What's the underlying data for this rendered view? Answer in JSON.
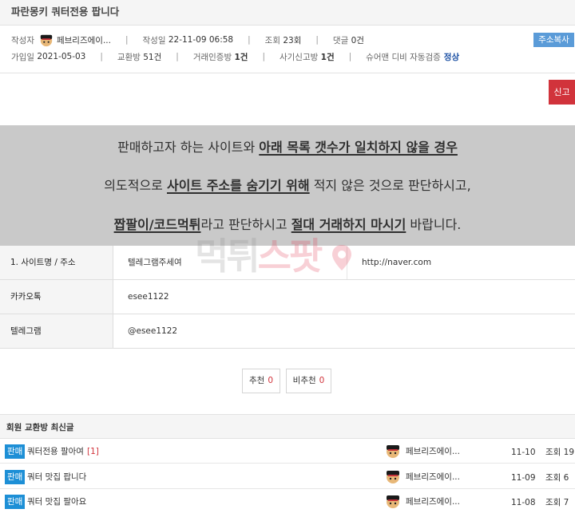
{
  "post": {
    "title": "파란몽키 쿼터전용 팝니다"
  },
  "meta": {
    "author_label": "작성자",
    "author_name": "페브리즈에이...",
    "date_label": "작성일",
    "date_value": "22-11-09 06:58",
    "views_label": "조회",
    "views_value": "23회",
    "comments_label": "댓글",
    "comments_value": "0건",
    "copy_button": "주소복사",
    "joined_label": "가입일",
    "joined_value": "2021-05-03",
    "exchange_label": "교환방",
    "exchange_value": "51건",
    "trade_cert_label": "거래인증방",
    "trade_cert_value": "1건",
    "fraud_report_label": "사기신고방",
    "fraud_report_value": "1건",
    "db_check_label": "슈어맨 디비 자동검증",
    "db_check_value": "정상"
  },
  "report_button": "신고",
  "notice": {
    "l1_pre": "판매하고자 하는 사이트와 ",
    "l1_bold": "아래 목록 갯수가 일치하지 않을 경우",
    "l2_pre": "의도적으로 ",
    "l2_bold": "사이트 주소를 숨기기 위해",
    "l2_post": " 적지 않은 것으로 판단하시고,",
    "l3_bold1": "짭팔이/코드먹튀",
    "l3_mid": "라고 판단하시고 ",
    "l3_bold2": "절대 거래하지 마시기",
    "l3_post": " 바랍니다."
  },
  "watermark": {
    "part1": "먹튀",
    "part2": "스팟"
  },
  "info": {
    "site_label": "1. 사이트명 / 주소",
    "site_name": "텔레그램주세여",
    "site_url": "http://naver.com",
    "kakao_label": "카카오톡",
    "kakao_value": "esee1122",
    "telegram_label": "텔레그램",
    "telegram_value": "@esee1122"
  },
  "votes": {
    "up_label": "추천",
    "up_count": "0",
    "down_label": "비추천",
    "down_count": "0"
  },
  "recent": {
    "heading": "회원 교환방 최신글",
    "posts": [
      {
        "tag": "판매",
        "subject": "쿼터전용 팔아여",
        "comments": "[1]",
        "author": "페브리즈에이...",
        "date": "11-10",
        "views": "조회 19"
      },
      {
        "tag": "판매",
        "subject": "쿼터 맛집 팝니다",
        "comments": "",
        "author": "페브리즈에이...",
        "date": "11-09",
        "views": "조회 6"
      },
      {
        "tag": "판매",
        "subject": "쿼터 맛집 팔아요",
        "comments": "",
        "author": "페브리즈에이...",
        "date": "11-08",
        "views": "조회 7"
      }
    ]
  }
}
